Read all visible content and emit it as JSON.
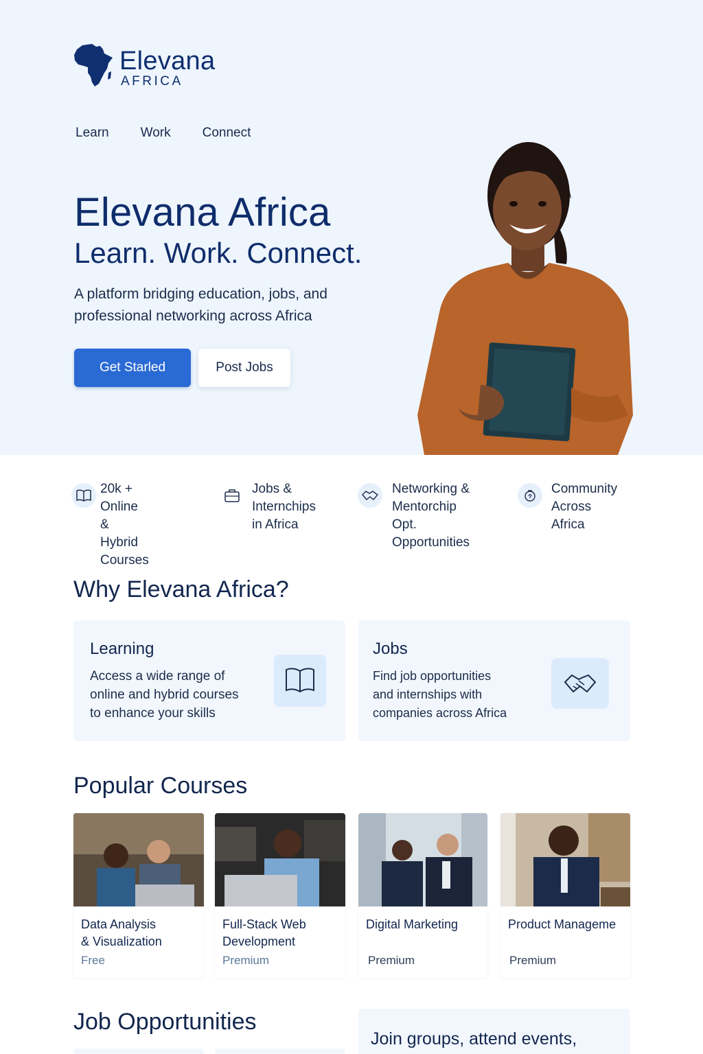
{
  "brand": {
    "name": "Elevana",
    "sub": "AFRICA"
  },
  "nav": {
    "items": [
      "Learn",
      "Work",
      "Connect"
    ]
  },
  "hero": {
    "title": "Elevana Africa",
    "tagline": "Learn. Work. Connect.",
    "description": "A platform bridging education, jobs, and professional networking across Africa",
    "primary_button": "Get Starled",
    "secondary_button": "Post Jobs"
  },
  "features": [
    {
      "icon": "book-icon",
      "line1": "20k + Online &",
      "line2": "Hybrid Courses",
      "line3": ""
    },
    {
      "icon": "briefcase-icon",
      "line1": "Jobs &",
      "line2": "Internchips",
      "line3": "in Africa"
    },
    {
      "icon": "handshake-icon",
      "line1": "Networking &",
      "line2": "Mentorchip Opt.",
      "line3": "Opportunities"
    },
    {
      "icon": "community-icon",
      "line1": "Community",
      "line2": "Across Africa",
      "line3": ""
    }
  ],
  "why": {
    "title": "Why Elevana Africa?",
    "cards": [
      {
        "title": "Learning",
        "lines": [
          "Access a wide range of",
          "online and hybrid courses",
          "to enhance your skills"
        ],
        "icon": "open-book-icon"
      },
      {
        "title": "Jobs",
        "lines": [
          "Find job opportunities",
          "and internships with",
          "companies across Africa"
        ],
        "icon": "handshake-icon"
      }
    ]
  },
  "courses": {
    "title": "Popular Courses",
    "items": [
      {
        "line1": "Data Analysis",
        "line2": "& Visualization",
        "tier": "Free"
      },
      {
        "line1": "Full-Stack Web",
        "line2": "Development",
        "tier": "Premium"
      },
      {
        "line1": "Digital Marketing",
        "line2": "",
        "tier": "Premium"
      },
      {
        "line1": "Product Manageme",
        "line2": "",
        "tier": "Premium"
      }
    ]
  },
  "jobs": {
    "title": "Job Opportunities"
  },
  "community": {
    "headline": "Join groups, attend events,"
  },
  "colors": {
    "brand": "#0f2f70",
    "accent": "#2a6ad4",
    "hero_bg": "#eef5fd",
    "card_bg": "#f2f7fd"
  }
}
